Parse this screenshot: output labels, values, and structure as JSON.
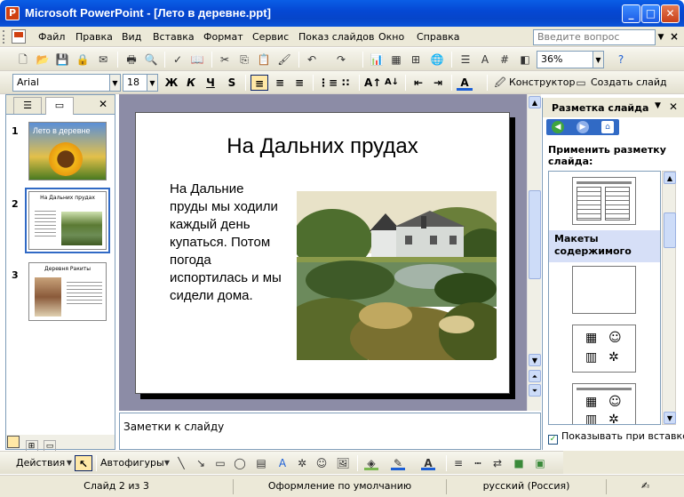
{
  "window": {
    "title": "Microsoft PowerPoint - [Лето в деревне.ppt]",
    "buttons": {
      "minimize": "_",
      "maximize": "□",
      "close": "✕"
    }
  },
  "menu": {
    "items": [
      "Файл",
      "Правка",
      "Вид",
      "Вставка",
      "Формат",
      "Сервис",
      "Показ слайдов",
      "Окно",
      "Справка"
    ],
    "search_placeholder": "Введите вопрос",
    "close": "×"
  },
  "toolbar_standard": {
    "zoom": "36%"
  },
  "toolbar_format": {
    "font": "Arial",
    "size": "18",
    "bold": "Ж",
    "italic": "К",
    "underline": "Ч",
    "shadow": "S",
    "designer": "Конструктор",
    "new_slide": "Создать слайд"
  },
  "outline_pane": {
    "close": "✕",
    "thumbnails": [
      {
        "number": "1",
        "title": "Лето в деревне"
      },
      {
        "number": "2",
        "title": "На Дальних прудах"
      },
      {
        "number": "3",
        "title": "Деревня Ракиты"
      }
    ]
  },
  "slide": {
    "title": "На Дальних прудах",
    "body": "На Дальние пруды мы ходили каждый день купаться. Потом погода испортилась и мы сидели дома."
  },
  "notes": {
    "placeholder": "Заметки к слайду"
  },
  "task_pane": {
    "title": "Разметка слайда",
    "apply_label": "Применить разметку слайда:",
    "group_label": "Макеты содержимого",
    "show_on_insert": "Показывать при вставке с"
  },
  "drawing_toolbar": {
    "actions": "Действия",
    "autoshapes": "Автофигуры"
  },
  "statusbar": {
    "slide_info": "Слайд 2 из 3",
    "design": "Оформление по умолчанию",
    "language": "русский (Россия)"
  }
}
